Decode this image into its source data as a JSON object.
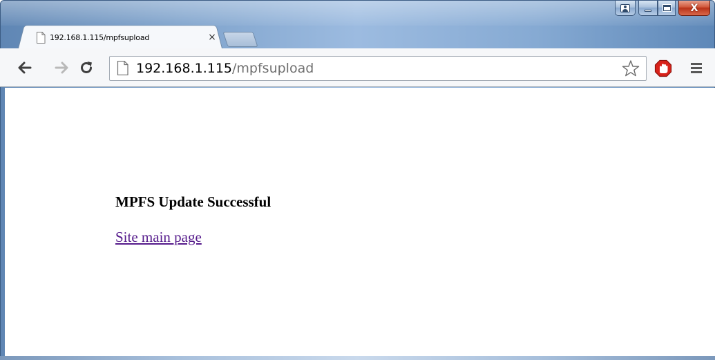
{
  "browser": {
    "tab": {
      "title": "192.168.1.115/mpfsupload",
      "close_label": "×"
    },
    "caption_buttons": {
      "close_label": "X"
    },
    "address_bar": {
      "host": "192.168.1.115",
      "path": "/mpfsupload"
    },
    "icons": {
      "back": "back-arrow-icon",
      "forward": "forward-arrow-icon",
      "reload": "reload-icon",
      "page": "page-icon",
      "bookmark": "star-icon",
      "extension": "adblock-icon",
      "menu": "menu-icon"
    }
  },
  "page": {
    "heading": "MPFS Update Successful",
    "link_text": "Site main page"
  },
  "colors": {
    "link_visited": "#551a8b",
    "close_button": "#c7432a",
    "adblock_red": "#d8221a"
  }
}
